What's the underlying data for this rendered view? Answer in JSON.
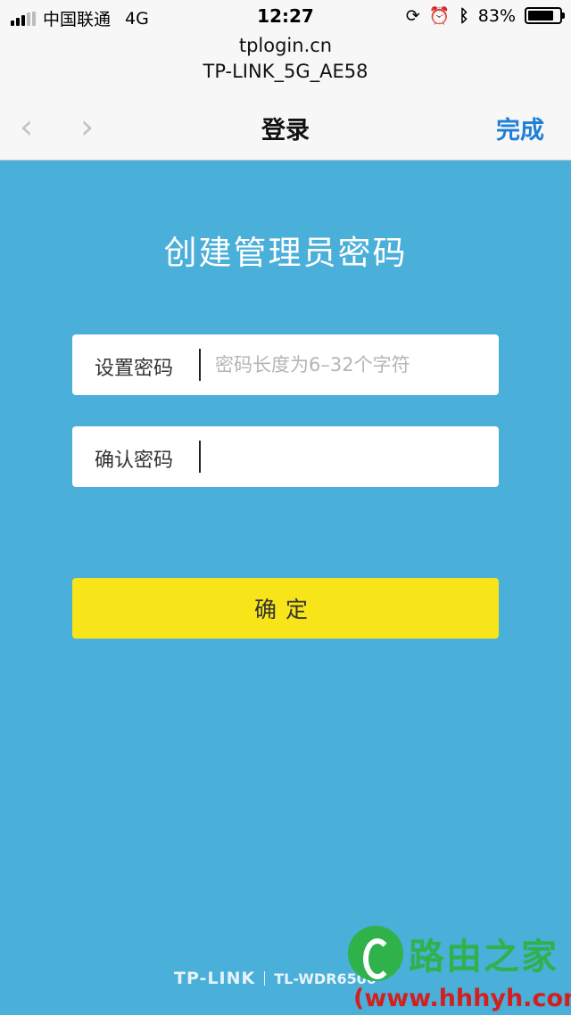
{
  "status_bar": {
    "carrier": "中国联通",
    "network": "4G",
    "time": "12:27",
    "battery_percent": "83%",
    "battery_level": 0.83
  },
  "browser": {
    "url": "tplogin.cn",
    "page_subtitle": "TP-LINK_5G_AE58",
    "nav_title": "登录",
    "done_label": "完成",
    "back_icon": "‹",
    "forward_icon": "›"
  },
  "form": {
    "heading": "创建管理员密码",
    "password_label": "设置密码",
    "password_placeholder": "密码长度为6–32个字符",
    "confirm_label": "确认密码",
    "confirm_placeholder": "",
    "submit_label": "确定"
  },
  "footer": {
    "brand": "TP-LINK",
    "model": "TL-WDR6500"
  },
  "watermark": {
    "name": "路由之家",
    "url": "(www.hhhyh.com"
  },
  "colors": {
    "background": "#4aafd9",
    "button": "#f7e51a",
    "link": "#1f7fd6"
  }
}
